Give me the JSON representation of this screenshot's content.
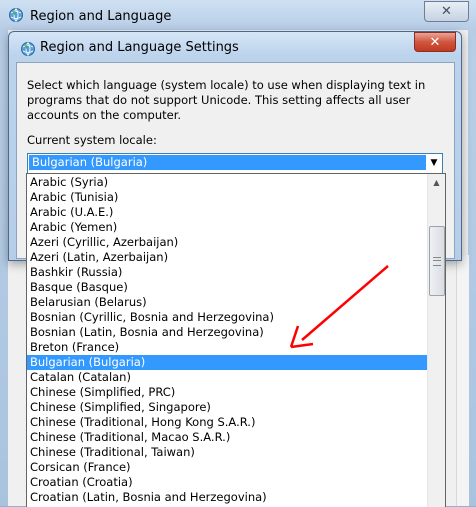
{
  "outer_window": {
    "title": "Region and Language",
    "close_glyph": "✕",
    "icon": "globe-icon"
  },
  "dialog": {
    "title": "Region and Language Settings",
    "close_glyph": "✕",
    "icon": "globe-icon",
    "description": "Select which language (system locale) to use when displaying text in programs that do not support Unicode. This setting affects all user accounts on the computer.",
    "locale_label": "Current system locale:",
    "locale_value": "Bulgarian (Bulgaria)",
    "dropdown_arrow": "▼"
  },
  "locale_list": {
    "items": [
      "Arabic (Syria)",
      "Arabic (Tunisia)",
      "Arabic (U.A.E.)",
      "Arabic (Yemen)",
      "Azeri (Cyrillic, Azerbaijan)",
      "Azeri (Latin, Azerbaijan)",
      "Bashkir (Russia)",
      "Basque (Basque)",
      "Belarusian (Belarus)",
      "Bosnian (Cyrillic, Bosnia and Herzegovina)",
      "Bosnian (Latin, Bosnia and Herzegovina)",
      "Breton (France)",
      "Bulgarian (Bulgaria)",
      "Catalan (Catalan)",
      "Chinese (Simplified, PRC)",
      "Chinese (Simplified, Singapore)",
      "Chinese (Traditional, Hong Kong S.A.R.)",
      "Chinese (Traditional, Macao S.A.R.)",
      "Chinese (Traditional, Taiwan)",
      "Corsican (France)",
      "Croatian (Croatia)",
      "Croatian (Latin, Bosnia and Herzegovina)"
    ],
    "selected_index": 12,
    "scroll_up_glyph": "▲"
  },
  "colors": {
    "selection": "#3399ff",
    "annotation_arrow": "#ff0000"
  }
}
